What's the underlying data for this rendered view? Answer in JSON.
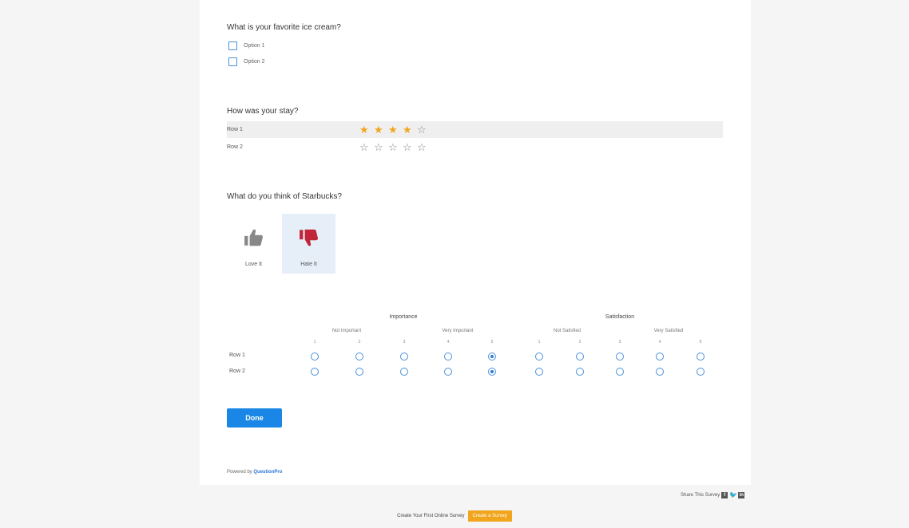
{
  "q1": {
    "title": "What is your favorite ice cream?",
    "options": [
      "Option 1",
      "Option 2"
    ]
  },
  "q2": {
    "title": "How was your stay?",
    "rows": [
      {
        "label": "Row 1",
        "rating": 4,
        "max": 5
      },
      {
        "label": "Row 2",
        "rating": 0,
        "max": 5
      }
    ]
  },
  "q3": {
    "title": "What do you think of Starbucks?",
    "choices": [
      {
        "label": "Love It",
        "icon": "thumbs-up-icon",
        "selected": false
      },
      {
        "label": "Hate It",
        "icon": "thumbs-down-icon",
        "selected": true
      }
    ]
  },
  "q4": {
    "importance": {
      "title": "Importance",
      "low": "Not Important",
      "high": "Very Important"
    },
    "satisfaction": {
      "title": "Satisfaction",
      "low": "Not Satisfied",
      "high": "Very Satisfied"
    },
    "scale": [
      "1",
      "2",
      "3",
      "4",
      "5"
    ],
    "rows": [
      {
        "label": "Row 1",
        "importance": 5,
        "satisfaction": 0
      },
      {
        "label": "Row 2",
        "importance": 5,
        "satisfaction": 0
      }
    ]
  },
  "done_label": "Done",
  "powered_prefix": "Powered by",
  "powered_brand": "QuestionPro",
  "share_label": "Share This Survey",
  "footer": {
    "text": "Create Your First Online Survey",
    "button": "Create a Survey"
  },
  "colors": {
    "accent": "#1a87e6",
    "star": "#f0a51c",
    "thumb_down": "#c0253a",
    "thumb_up": "#888888",
    "cta": "#f0a51c"
  }
}
